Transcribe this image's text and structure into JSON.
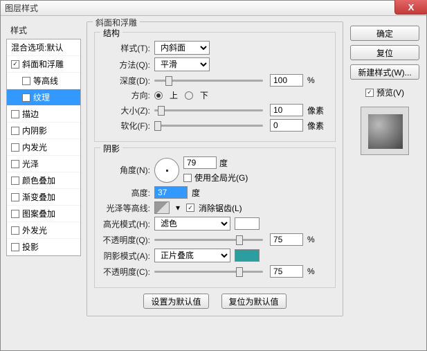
{
  "window": {
    "title": "图层样式"
  },
  "left": {
    "heading": "样式",
    "items": [
      {
        "label": "混合选项:默认",
        "checked": null
      },
      {
        "label": "斜面和浮雕",
        "checked": true,
        "selected": false
      },
      {
        "label": "等高线",
        "checked": false,
        "sub": true
      },
      {
        "label": "纹理",
        "checked": false,
        "sub": true,
        "selected": true
      },
      {
        "label": "描边",
        "checked": false
      },
      {
        "label": "内阴影",
        "checked": false
      },
      {
        "label": "内发光",
        "checked": false
      },
      {
        "label": "光泽",
        "checked": false
      },
      {
        "label": "颜色叠加",
        "checked": false
      },
      {
        "label": "渐变叠加",
        "checked": false
      },
      {
        "label": "图案叠加",
        "checked": false
      },
      {
        "label": "外发光",
        "checked": false
      },
      {
        "label": "投影",
        "checked": false
      }
    ]
  },
  "bevel": {
    "group_title": "斜面和浮雕",
    "structure_title": "结构",
    "style_label": "样式(T):",
    "style_value": "内斜面",
    "technique_label": "方法(Q):",
    "technique_value": "平滑",
    "depth_label": "深度(D):",
    "depth_value": "100",
    "percent": "%",
    "direction_label": "方向:",
    "dir_up": "上",
    "dir_down": "下",
    "size_label": "大小(Z):",
    "size_value": "10",
    "px": "像素",
    "soften_label": "软化(F):",
    "soften_value": "0",
    "shading_title": "阴影",
    "angle_label": "角度(N):",
    "angle_value": "79",
    "deg": "度",
    "global_label": "使用全局光(G)",
    "altitude_label": "高度:",
    "altitude_value": "37",
    "gloss_label": "光泽等高线:",
    "aa_label": "消除锯齿(L)",
    "hmode_label": "高光模式(H):",
    "hmode_value": "滤色",
    "hopacity_label": "不透明度(Q):",
    "hopacity_value": "75",
    "smode_label": "阴影模式(A):",
    "smode_value": "正片叠底",
    "sopacity_label": "不透明度(C):",
    "sopacity_value": "75",
    "btn_default": "设置为默认值",
    "btn_reset": "复位为默认值"
  },
  "right": {
    "ok": "确定",
    "cancel": "复位",
    "newstyle": "新建样式(W)...",
    "preview_label": "预览(V)"
  }
}
